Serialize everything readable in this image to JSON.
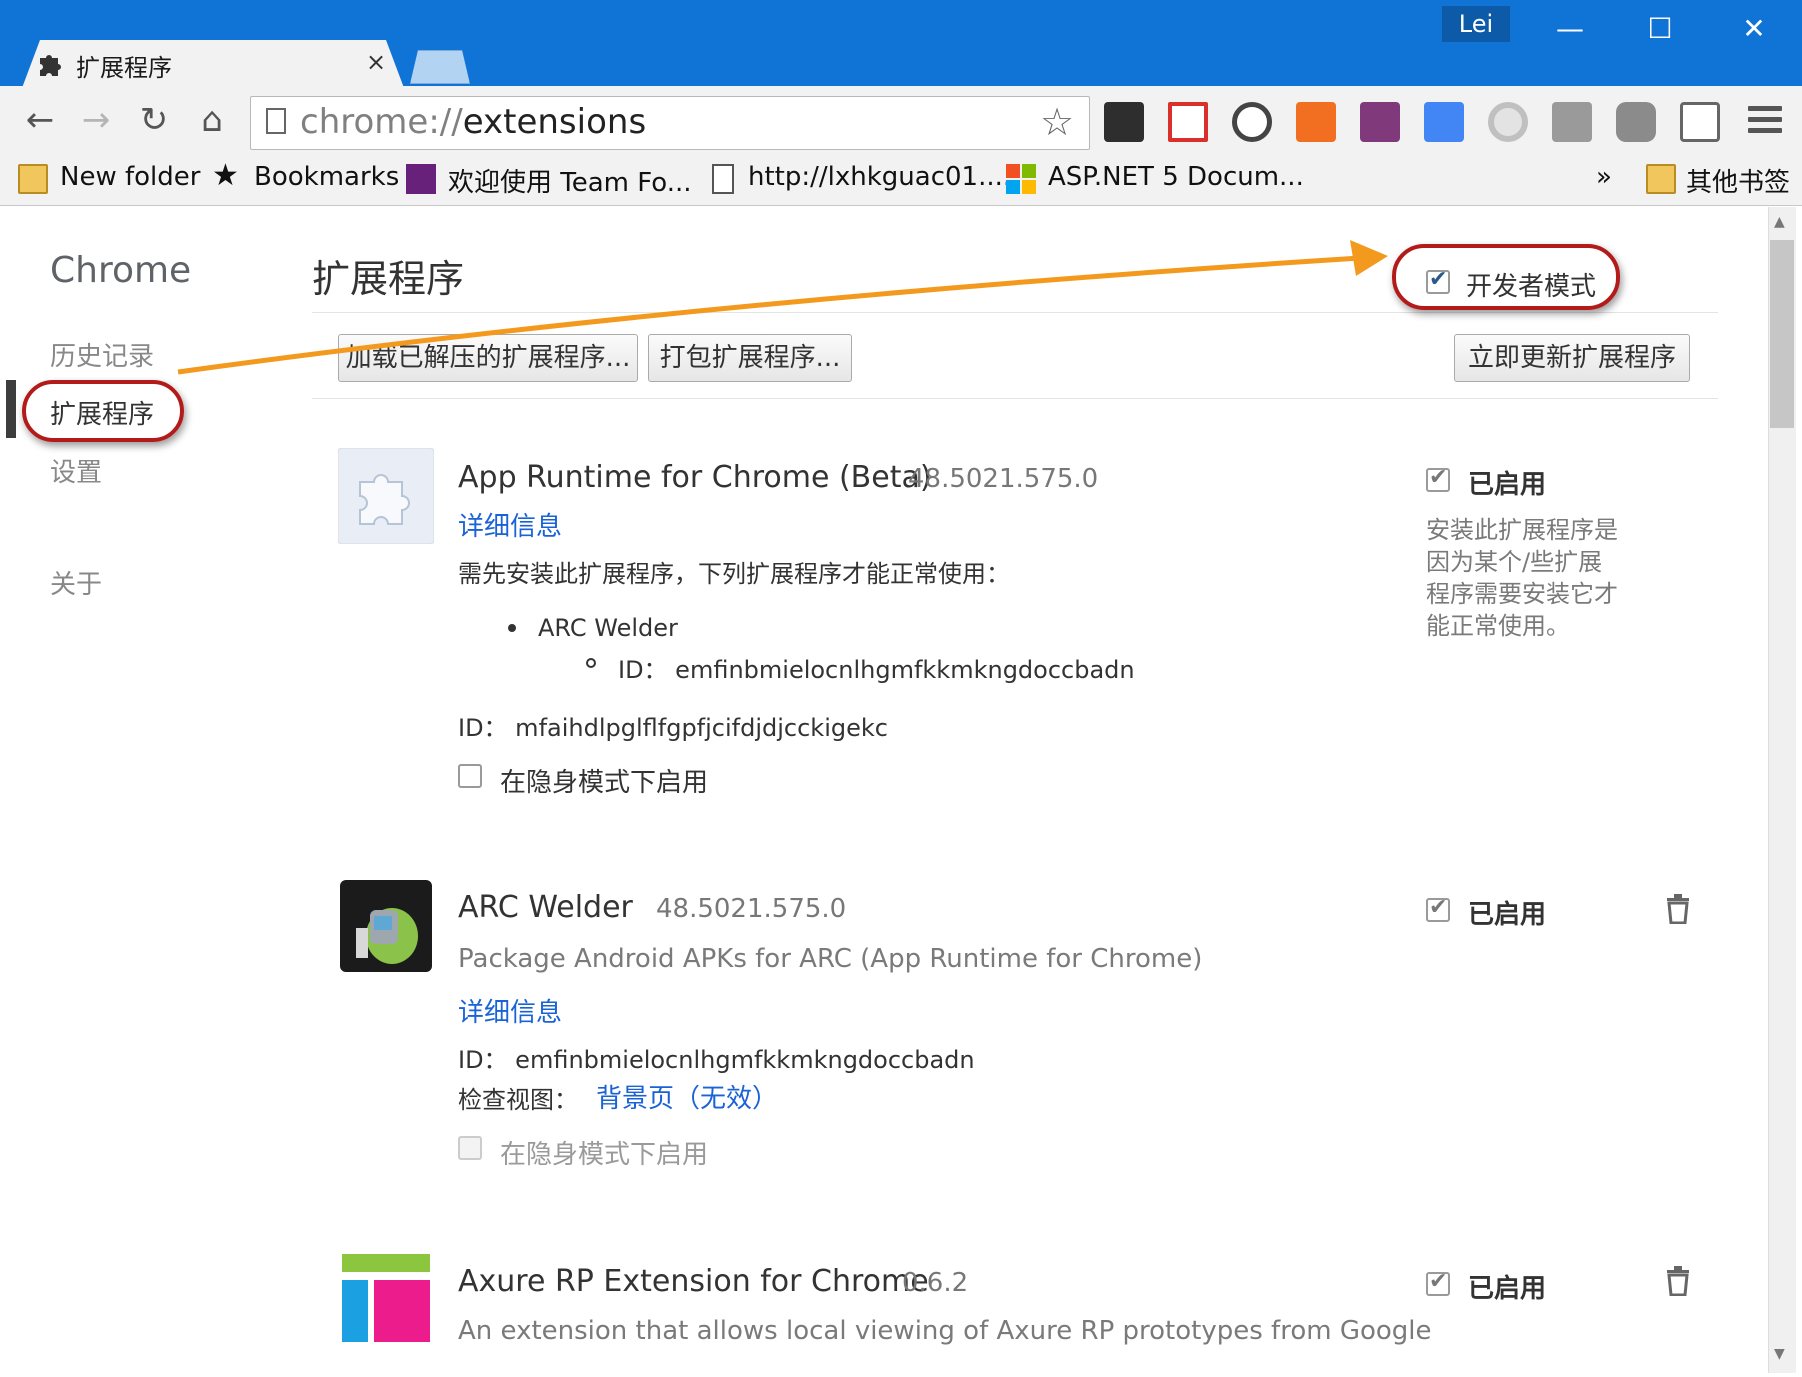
{
  "window": {
    "tab_title": "扩展程序",
    "tab_close": "×",
    "user": "Lei",
    "minimize": "—",
    "maximize": "☐",
    "close": "✕"
  },
  "toolbar": {
    "back": "←",
    "forward": "→",
    "reload": "↻",
    "home": "⌂",
    "url_scheme": "chrome://",
    "url_rest": "extensions",
    "star": "☆"
  },
  "bookmarks": {
    "items": [
      "New folder",
      "Bookmarks",
      "欢迎使用 Team Fo...",
      "http://lxhkguac01....",
      "ASP.NET 5 Docum..."
    ],
    "overflow": "»",
    "other": "其他书签"
  },
  "sidebar": {
    "title": "Chrome",
    "items": [
      "历史记录",
      "扩展程序",
      "设置",
      "关于"
    ]
  },
  "main": {
    "title": "扩展程序",
    "dev_mode_label": "开发者模式",
    "buttons": {
      "load_unpacked": "加载已解压的扩展程序...",
      "pack": "打包扩展程序...",
      "update": "立即更新扩展程序"
    }
  },
  "extensions": [
    {
      "name": "App Runtime for Chrome (Beta)",
      "version": "48.5021.575.0",
      "details_link": "详细信息",
      "dependency_text": "需先安装此扩展程序，下列扩展程序才能正常使用：",
      "dependent_name": "ARC Welder",
      "dependent_id": "ID： emfinbmielocnlhgmfkkmkngdoccbadn",
      "id": "ID： mfaihdlpglflfgpfjcifdjdjcckigekc",
      "incognito": "在隐身模式下启用",
      "enabled_label": "已启用",
      "note": [
        "安装此扩展程序是",
        "因为某个/些扩展",
        "程序需要安装它才",
        "能正常使用。"
      ]
    },
    {
      "name": "ARC Welder",
      "version": "48.5021.575.0",
      "description": "Package Android APKs for ARC (App Runtime for Chrome)",
      "details_link": "详细信息",
      "id": "ID： emfinbmielocnlhgmfkkmkngdoccbadn",
      "inspect_label": "检查视图：",
      "inspect_link": "背景页（无效）",
      "incognito": "在隐身模式下启用",
      "enabled_label": "已启用"
    },
    {
      "name": "Axure RP Extension for Chrome",
      "version": "0.6.2",
      "description": "An extension that allows local viewing of Axure RP prototypes from Google",
      "enabled_label": "已启用"
    }
  ],
  "colors": {
    "titlebar": "#0f74d6",
    "link": "#1a63d6",
    "annotation_ring": "#b31b1b",
    "annotation_arrow": "#f39a1e"
  }
}
